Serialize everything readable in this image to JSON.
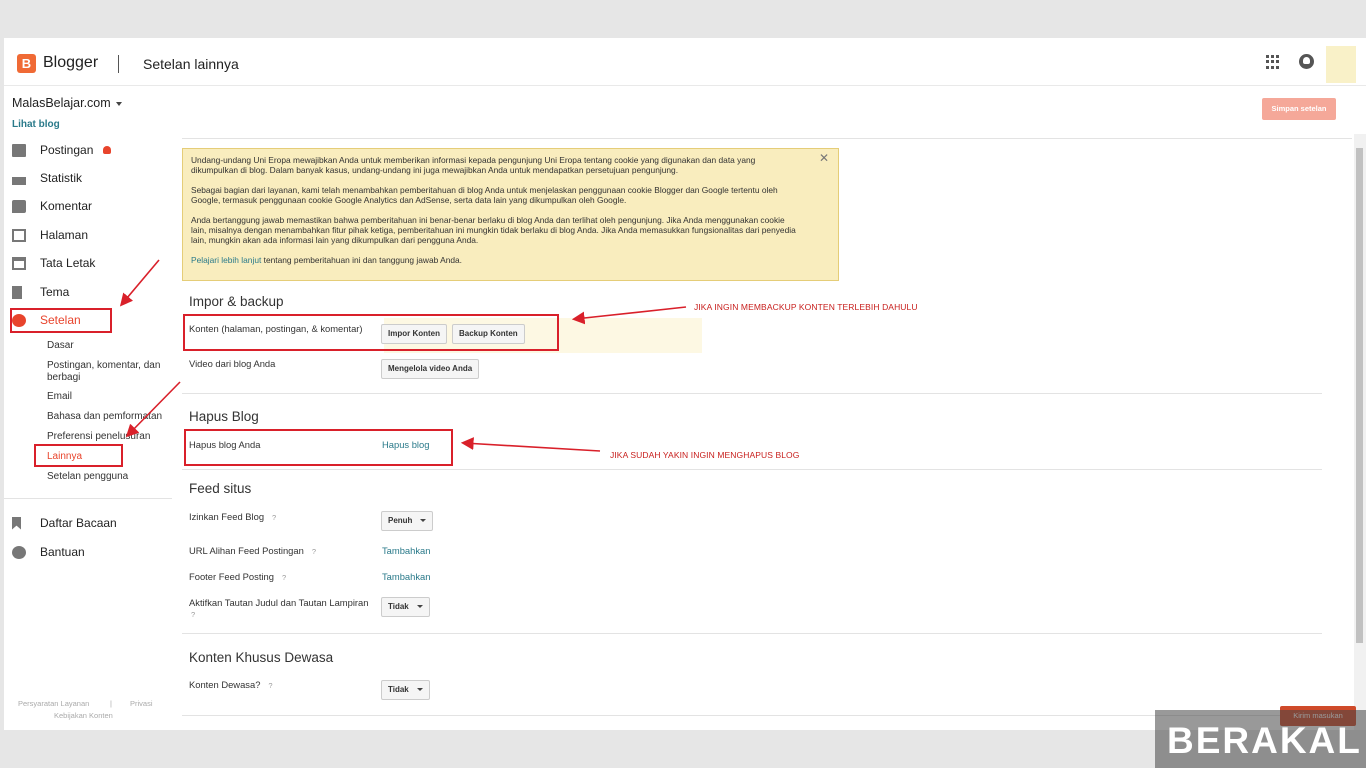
{
  "header": {
    "logo_letter": "B",
    "brand": "Blogger",
    "title": "Setelan lainnya"
  },
  "sidebar": {
    "blog_name": "MalasBelajar.com",
    "view_blog": "Lihat blog",
    "items": [
      {
        "label": "Postingan",
        "icon": "posts-icon"
      },
      {
        "label": "Statistik",
        "icon": "stats-icon"
      },
      {
        "label": "Komentar",
        "icon": "comments-icon"
      },
      {
        "label": "Halaman",
        "icon": "pages-icon"
      },
      {
        "label": "Tata Letak",
        "icon": "layout-icon"
      },
      {
        "label": "Tema",
        "icon": "theme-icon"
      },
      {
        "label": "Setelan",
        "icon": "gear-icon"
      }
    ],
    "subitems": [
      "Dasar",
      "Postingan, komentar, dan berbagi",
      "Email",
      "Bahasa dan pemformatan",
      "Preferensi penelusuran",
      "Lainnya",
      "Setelan pengguna"
    ],
    "bottom_items": [
      {
        "label": "Daftar Bacaan",
        "icon": "bookmark-icon"
      },
      {
        "label": "Bantuan",
        "icon": "help-icon"
      }
    ],
    "footer": {
      "terms": "Persyaratan Layanan",
      "privacy": "Privasi",
      "content_policy": "Kebijakan Konten"
    }
  },
  "toolbar": {
    "save_label": "Simpan setelan"
  },
  "notice": {
    "p1": "Undang-undang Uni Eropa mewajibkan Anda untuk memberikan informasi kepada pengunjung Uni Eropa tentang cookie yang digunakan dan data yang dikumpulkan di blog. Dalam banyak kasus, undang-undang ini juga mewajibkan Anda untuk mendapatkan persetujuan pengunjung.",
    "p2": "Sebagai bagian dari layanan, kami telah menambahkan pemberitahuan di blog Anda untuk menjelaskan penggunaan cookie Blogger dan Google tertentu oleh Google, termasuk penggunaan cookie Google Analytics dan AdSense, serta data lain yang dikumpulkan oleh Google.",
    "p3": "Anda bertanggung jawab memastikan bahwa pemberitahuan ini benar-benar berlaku di blog Anda dan terlihat oleh pengunjung. Jika Anda menggunakan cookie lain, misalnya dengan menambahkan fitur pihak ketiga, pemberitahuan ini mungkin tidak berlaku di blog Anda. Jika Anda memasukkan fungsionalitas dari penyedia lain, mungkin akan ada informasi lain yang dikumpulkan dari pengguna Anda.",
    "learn_more": "Pelajari lebih lanjut",
    "learn_more_rest": " tentang pemberitahuan ini dan tanggung jawab Anda."
  },
  "import_backup": {
    "title": "Impor & backup",
    "content_label": "Konten (halaman, postingan, & komentar)",
    "import_btn": "Impor Konten",
    "backup_btn": "Backup Konten",
    "video_label": "Video dari blog Anda",
    "video_btn": "Mengelola video Anda"
  },
  "delete_blog": {
    "title": "Hapus Blog",
    "label": "Hapus blog Anda",
    "link": "Hapus blog"
  },
  "feed": {
    "title": "Feed situs",
    "allow_label": "Izinkan Feed Blog",
    "allow_value": "Penuh",
    "redirect_label": "URL Alihan Feed Postingan",
    "redirect_link": "Tambahkan",
    "footer_label": "Footer Feed Posting",
    "footer_link": "Tambahkan",
    "enclosure_label": "Aktifkan Tautan Judul dan Tautan Lampiran",
    "enclosure_value": "Tidak"
  },
  "adult": {
    "title": "Konten Khusus Dewasa",
    "label": "Konten Dewasa?",
    "value": "Tidak"
  },
  "help_mark": "?",
  "annotations": {
    "backup": "JIKA INGIN MEMBACKUP KONTEN TERLEBIH DAHULU",
    "delete": "JIKA SUDAH YAKIN INGIN MENGHAPUS BLOG"
  },
  "feedback_label": "Kirim masukan",
  "watermark": "BERAKAL",
  "colors": {
    "accent": "#e8442c",
    "link": "#2a7a8a",
    "notice_bg": "#f9edbe",
    "annotation": "#d9202a"
  }
}
